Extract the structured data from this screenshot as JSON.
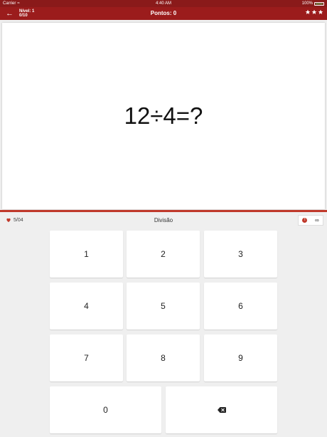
{
  "status_bar": {
    "carrier": "Carrier",
    "time": "4:40 AM",
    "battery": "100%"
  },
  "nav": {
    "level_label": "Nível: 1",
    "level_progress": "0/10",
    "title": "Pontos: 0",
    "stars_count": 3
  },
  "question": {
    "text": "12÷4=?"
  },
  "progress": {
    "fraction": 1.0
  },
  "info_bar": {
    "lives": "5/04",
    "category": "Divisão",
    "mode_symbol": "∞",
    "info_icon": "!"
  },
  "keypad": {
    "k1": "1",
    "k2": "2",
    "k3": "3",
    "k4": "4",
    "k5": "5",
    "k6": "6",
    "k7": "7",
    "k8": "8",
    "k9": "9",
    "k0": "0",
    "delete_icon": "backspace-icon"
  },
  "colors": {
    "primary": "#9b1c1c",
    "accent": "#c0392b",
    "background": "#efefef"
  }
}
